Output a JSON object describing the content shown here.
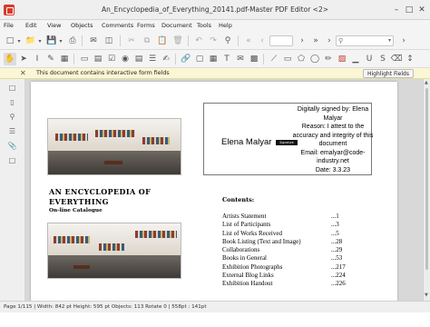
{
  "window": {
    "title": "An_Encyclopedia_of_Everything_20141.pdf-Master PDF Editor <2>",
    "app_icon": "master-pdf-editor-icon",
    "accent_color": "#d83b2b",
    "minimize_glyph": "–",
    "maximize_glyph": "□",
    "close_glyph": "✕"
  },
  "menu": [
    "File",
    "Edit",
    "View",
    "Objects",
    "Comments",
    "Forms",
    "Document",
    "Tools",
    "Help"
  ],
  "notice": {
    "close_glyph": "✕",
    "message": "This document contains interactive form fields",
    "button": "Highlight Fields",
    "bg_color": "#fbf6d3"
  },
  "document": {
    "signature": {
      "name": "Elena Malyar",
      "badge": "Signature",
      "details": [
        "Digitally signed by: Elena",
        "Malyar",
        "Reason: I attest to the",
        "accuracy and integrity of this",
        "document",
        "Email: emalyar@code-",
        "industry.net",
        "Date: 3.3.23"
      ]
    },
    "book_title_line1": "AN ENCYCLOPEDIA OF",
    "book_title_line2": "EVERYTHING",
    "book_subtitle": "On-line Catalogue",
    "contents_title": "Contents:",
    "toc": [
      {
        "label": "Artists Statement",
        "page": "...1"
      },
      {
        "label": "List of Participants",
        "page": "...3"
      },
      {
        "label": "List of Works Received",
        "page": "...5"
      },
      {
        "label": "Book Listing (Text and Image)",
        "page": "...28"
      },
      {
        "label": "Collaborations",
        "page": "...29"
      },
      {
        "label": "Books in General",
        "page": "...53"
      },
      {
        "label": "Exhibition Photographs",
        "page": "...217"
      },
      {
        "label": "External Blog Links",
        "page": "...224"
      },
      {
        "label": "Exhibition Handout",
        "page": "...226"
      }
    ]
  },
  "status": "Page 1/115 | Width: 842 pt Height: 595 pt Objects: 113 Rotate 0  |  558pt : 141pt"
}
